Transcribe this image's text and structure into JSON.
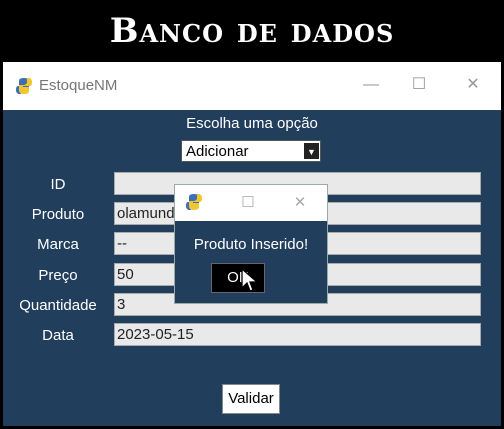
{
  "banner": {
    "title": "Banco de dados"
  },
  "window": {
    "title": "EstoqueNM",
    "minimize_icon": "—",
    "maximize_icon": "☐",
    "close_icon": "✕"
  },
  "form": {
    "heading": "Escolha uma opção",
    "option_selected": "Adicionar",
    "fields": [
      {
        "label": "ID",
        "value": ""
      },
      {
        "label": "Produto",
        "value": "olamundo"
      },
      {
        "label": "Marca",
        "value": "--"
      },
      {
        "label": "Preço",
        "value": "50"
      },
      {
        "label": "Quantidade",
        "value": "3"
      },
      {
        "label": "Data",
        "value": "2023-05-15"
      }
    ],
    "validate_label": "Validar"
  },
  "dialog": {
    "message": "Produto Inserido!",
    "ok_label": "OK",
    "maximize_icon": "☐",
    "close_icon": "✕"
  },
  "colors": {
    "window_bg": "#213e5d",
    "field_bg": "#e9e9e9",
    "logo_blue": "#3d6fb5",
    "logo_yellow": "#f2c630"
  },
  "icons": {
    "app_logo": "python-logo-icon",
    "cursor": "mouse-pointer-icon"
  }
}
